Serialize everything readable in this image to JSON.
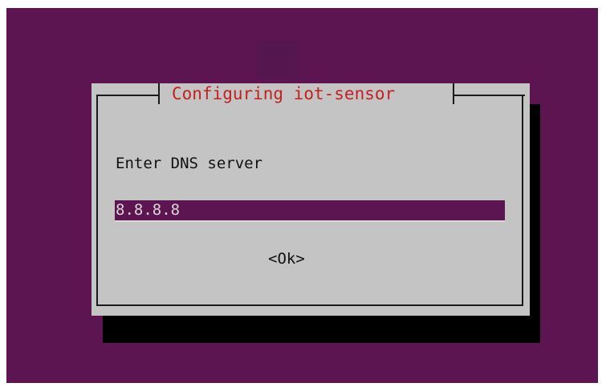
{
  "dialog": {
    "title": "Configuring iot-sensor",
    "prompt": "Enter DNS server",
    "input_value": "8.8.8.8",
    "ok_label": "<Ok>"
  },
  "colors": {
    "background": "#5c1550",
    "dialog": "#c4c4c4",
    "title": "#c42020",
    "input_bg": "#5c1550",
    "shadow": "#000000"
  }
}
